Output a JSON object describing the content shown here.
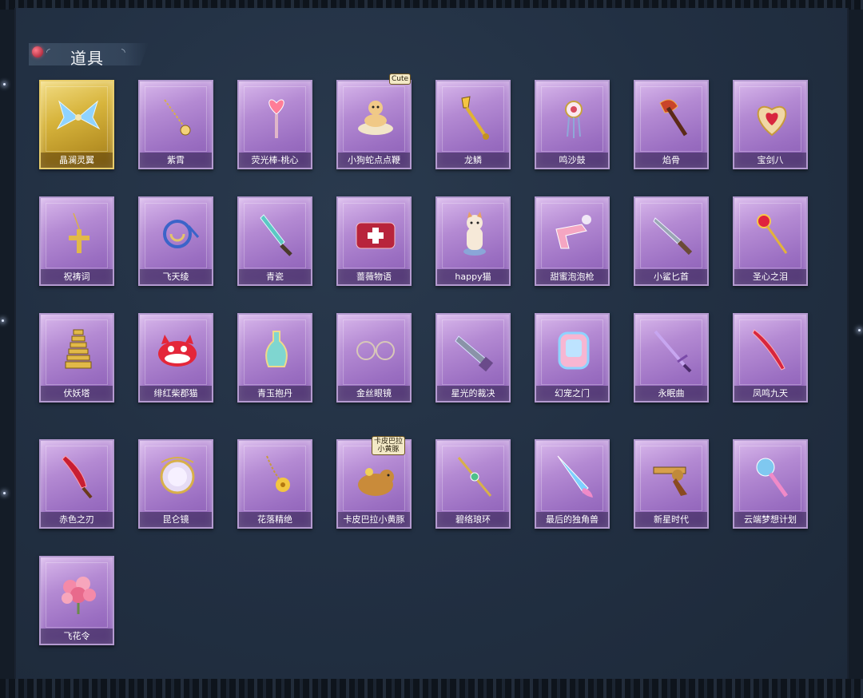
{
  "section": {
    "title": "道具"
  },
  "items": [
    {
      "name": "晶澜灵翼",
      "rarity": "gold",
      "icon": "crystal-wings-icon"
    },
    {
      "name": "紫霄",
      "rarity": "purple",
      "icon": "gold-chain-pendant-icon"
    },
    {
      "name": "荧光棒-桃心",
      "rarity": "purple",
      "icon": "heart-wand-icon"
    },
    {
      "name": "小狗蛇点点鞭",
      "rarity": "purple",
      "icon": "snake-whip-icon",
      "badge": "Cute"
    },
    {
      "name": "龙鳞",
      "rarity": "purple",
      "icon": "golden-shovel-icon"
    },
    {
      "name": "鸣沙鼓",
      "rarity": "purple",
      "icon": "dreamcatcher-drum-icon"
    },
    {
      "name": "焰骨",
      "rarity": "purple",
      "icon": "flame-axe-icon"
    },
    {
      "name": "宝剑八",
      "rarity": "purple",
      "icon": "heart-mirror-icon"
    },
    {
      "name": "祝祷词",
      "rarity": "purple",
      "icon": "cross-pendant-icon"
    },
    {
      "name": "飞天绫",
      "rarity": "purple",
      "icon": "ribbon-icon"
    },
    {
      "name": "青瓷",
      "rarity": "purple",
      "icon": "celadon-dagger-icon"
    },
    {
      "name": "蔷薇物语",
      "rarity": "purple",
      "icon": "medkit-icon"
    },
    {
      "name": "happy猫",
      "rarity": "purple",
      "icon": "cat-figure-icon"
    },
    {
      "name": "甜蜜泡泡枪",
      "rarity": "purple",
      "icon": "bubble-gun-icon"
    },
    {
      "name": "小鲨匕首",
      "rarity": "purple",
      "icon": "shark-dagger-icon"
    },
    {
      "name": "圣心之泪",
      "rarity": "purple",
      "icon": "ruby-scepter-icon"
    },
    {
      "name": "伏妖塔",
      "rarity": "purple",
      "icon": "pagoda-icon"
    },
    {
      "name": "绯红柴郡猫",
      "rarity": "purple",
      "icon": "cheshire-cat-icon"
    },
    {
      "name": "青玉抱丹",
      "rarity": "purple",
      "icon": "jade-vase-icon"
    },
    {
      "name": "金丝眼镜",
      "rarity": "purple",
      "icon": "glasses-icon"
    },
    {
      "name": "星光的裁决",
      "rarity": "purple",
      "icon": "star-rifle-icon"
    },
    {
      "name": "幻宠之门",
      "rarity": "purple",
      "icon": "pet-gate-icon"
    },
    {
      "name": "永眠曲",
      "rarity": "purple",
      "icon": "violet-sword-icon"
    },
    {
      "name": "凤鸣九天",
      "rarity": "purple",
      "icon": "phoenix-blade-icon"
    },
    {
      "name": "赤色之刃",
      "rarity": "purple",
      "icon": "crimson-blade-icon"
    },
    {
      "name": "昆仑镜",
      "rarity": "purple",
      "icon": "kunlun-mirror-icon"
    },
    {
      "name": "花落精绝",
      "rarity": "purple",
      "icon": "flower-chain-icon"
    },
    {
      "name": "卡皮巴拉小黄豚",
      "rarity": "purple",
      "icon": "capybara-icon",
      "badge": "卡皮巴拉\n小黄豚"
    },
    {
      "name": "碧络琅环",
      "rarity": "purple",
      "icon": "jade-staff-icon"
    },
    {
      "name": "最后的独角兽",
      "rarity": "purple",
      "icon": "unicorn-horn-icon"
    },
    {
      "name": "新星时代",
      "rarity": "purple",
      "icon": "revolver-icon"
    },
    {
      "name": "云端梦想计划",
      "rarity": "purple",
      "icon": "dream-mace-icon"
    },
    {
      "name": "飞花令",
      "rarity": "purple",
      "icon": "flower-bouquet-icon"
    }
  ]
}
